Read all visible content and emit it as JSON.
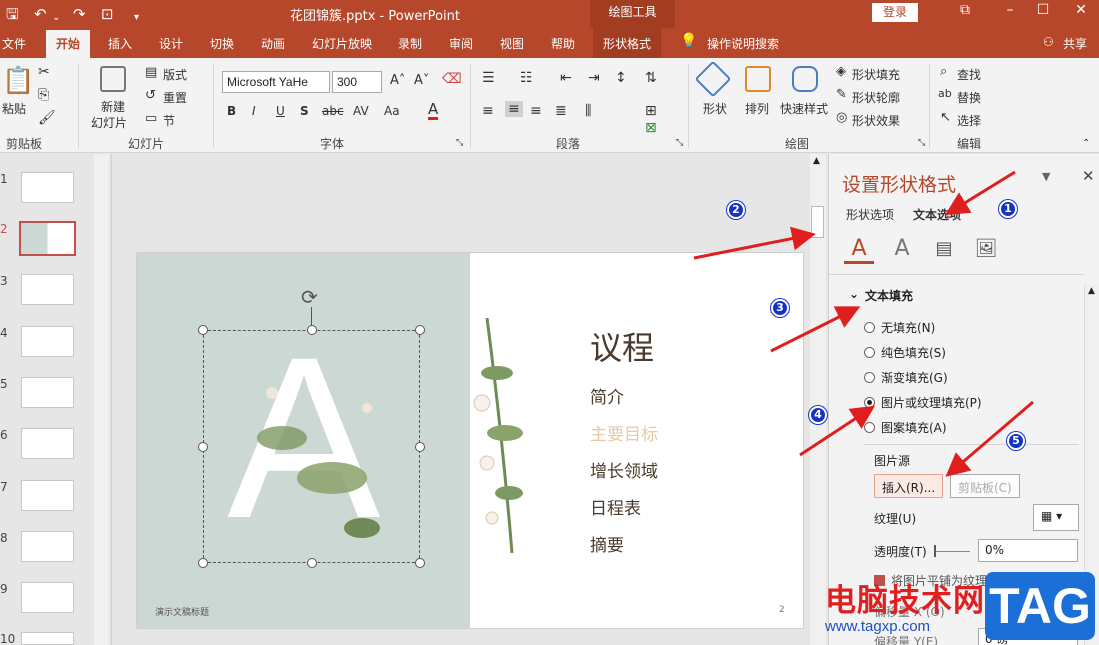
{
  "titlebar": {
    "doc_title": "花团锦簇.pptx  -  PowerPoint",
    "ctx_group": "绘图工具",
    "login": "登录",
    "icons": [
      "save-icon",
      "undo-icon",
      "redo-icon",
      "present-icon",
      "customize-icon"
    ]
  },
  "tabs": [
    "文件",
    "开始",
    "插入",
    "设计",
    "切换",
    "动画",
    "幻灯片放映",
    "录制",
    "审阅",
    "视图",
    "帮助",
    "形状格式"
  ],
  "active_tab": "开始",
  "tell_me": "操作说明搜索",
  "share": "共享",
  "ribbon": {
    "clipboard": {
      "paste": "粘贴",
      "label": "剪贴板"
    },
    "slides": {
      "new_slide_1": "新建",
      "new_slide_2": "幻灯片",
      "layout": "版式",
      "reset": "重置",
      "section": "节",
      "label": "幻灯片"
    },
    "font": {
      "name": "Microsoft YaHe",
      "size": "300",
      "bold": "B",
      "italic": "I",
      "underline": "U",
      "strike": "S",
      "label": "字体"
    },
    "paragraph": {
      "label": "段落"
    },
    "drawing": {
      "shape": "形状",
      "arrange": "排列",
      "quick_style": "快速样式",
      "fill": "形状填充",
      "outline": "形状轮廓",
      "effects": "形状效果",
      "label": "绘图"
    },
    "editing": {
      "find": "查找",
      "replace": "替换",
      "select": "选择",
      "label": "编辑"
    }
  },
  "thumbnails": [
    "1",
    "2",
    "3",
    "4",
    "5",
    "6",
    "7",
    "8",
    "9",
    "10"
  ],
  "selected_thumbnail": 2,
  "slide": {
    "big_letter": "A",
    "title": "议程",
    "items": [
      "简介",
      "主要目标",
      "增长领域",
      "日程表",
      "摘要"
    ],
    "highlighted_item": "主要目标",
    "footer": "演示文稿标题",
    "page": "2"
  },
  "format_pane": {
    "title": "设置形状格式",
    "tab_shape": "形状选项",
    "tab_text": "文本选项",
    "section": "文本填充",
    "options": [
      "无填充(N)",
      "纯色填充(S)",
      "渐变填充(G)",
      "图片或纹理填充(P)",
      "图案填充(A)"
    ],
    "selected_option": "图片或纹理填充(P)",
    "source_label": "图片源",
    "insert_btn": "插入(R)...",
    "clipboard_btn": "剪贴板(C)",
    "texture_label": "纹理(U)",
    "transparency_label": "透明度(T)",
    "transparency_value": "0%",
    "tile_label": "将图片平铺为纹理(I)",
    "offset_x": "偏移量 X (O)",
    "offset_y": "偏移量 Y(E)",
    "offset_y_value": "0 磅"
  },
  "badges": [
    "1",
    "2",
    "3",
    "4",
    "5"
  ],
  "watermark": {
    "cn": "电脑技术网",
    "url": "www.tagxp.com",
    "tag": "TAG"
  },
  "colors": {
    "accent": "#b7472a",
    "arrow": "#e01e1e",
    "badge": "#1533c7"
  }
}
